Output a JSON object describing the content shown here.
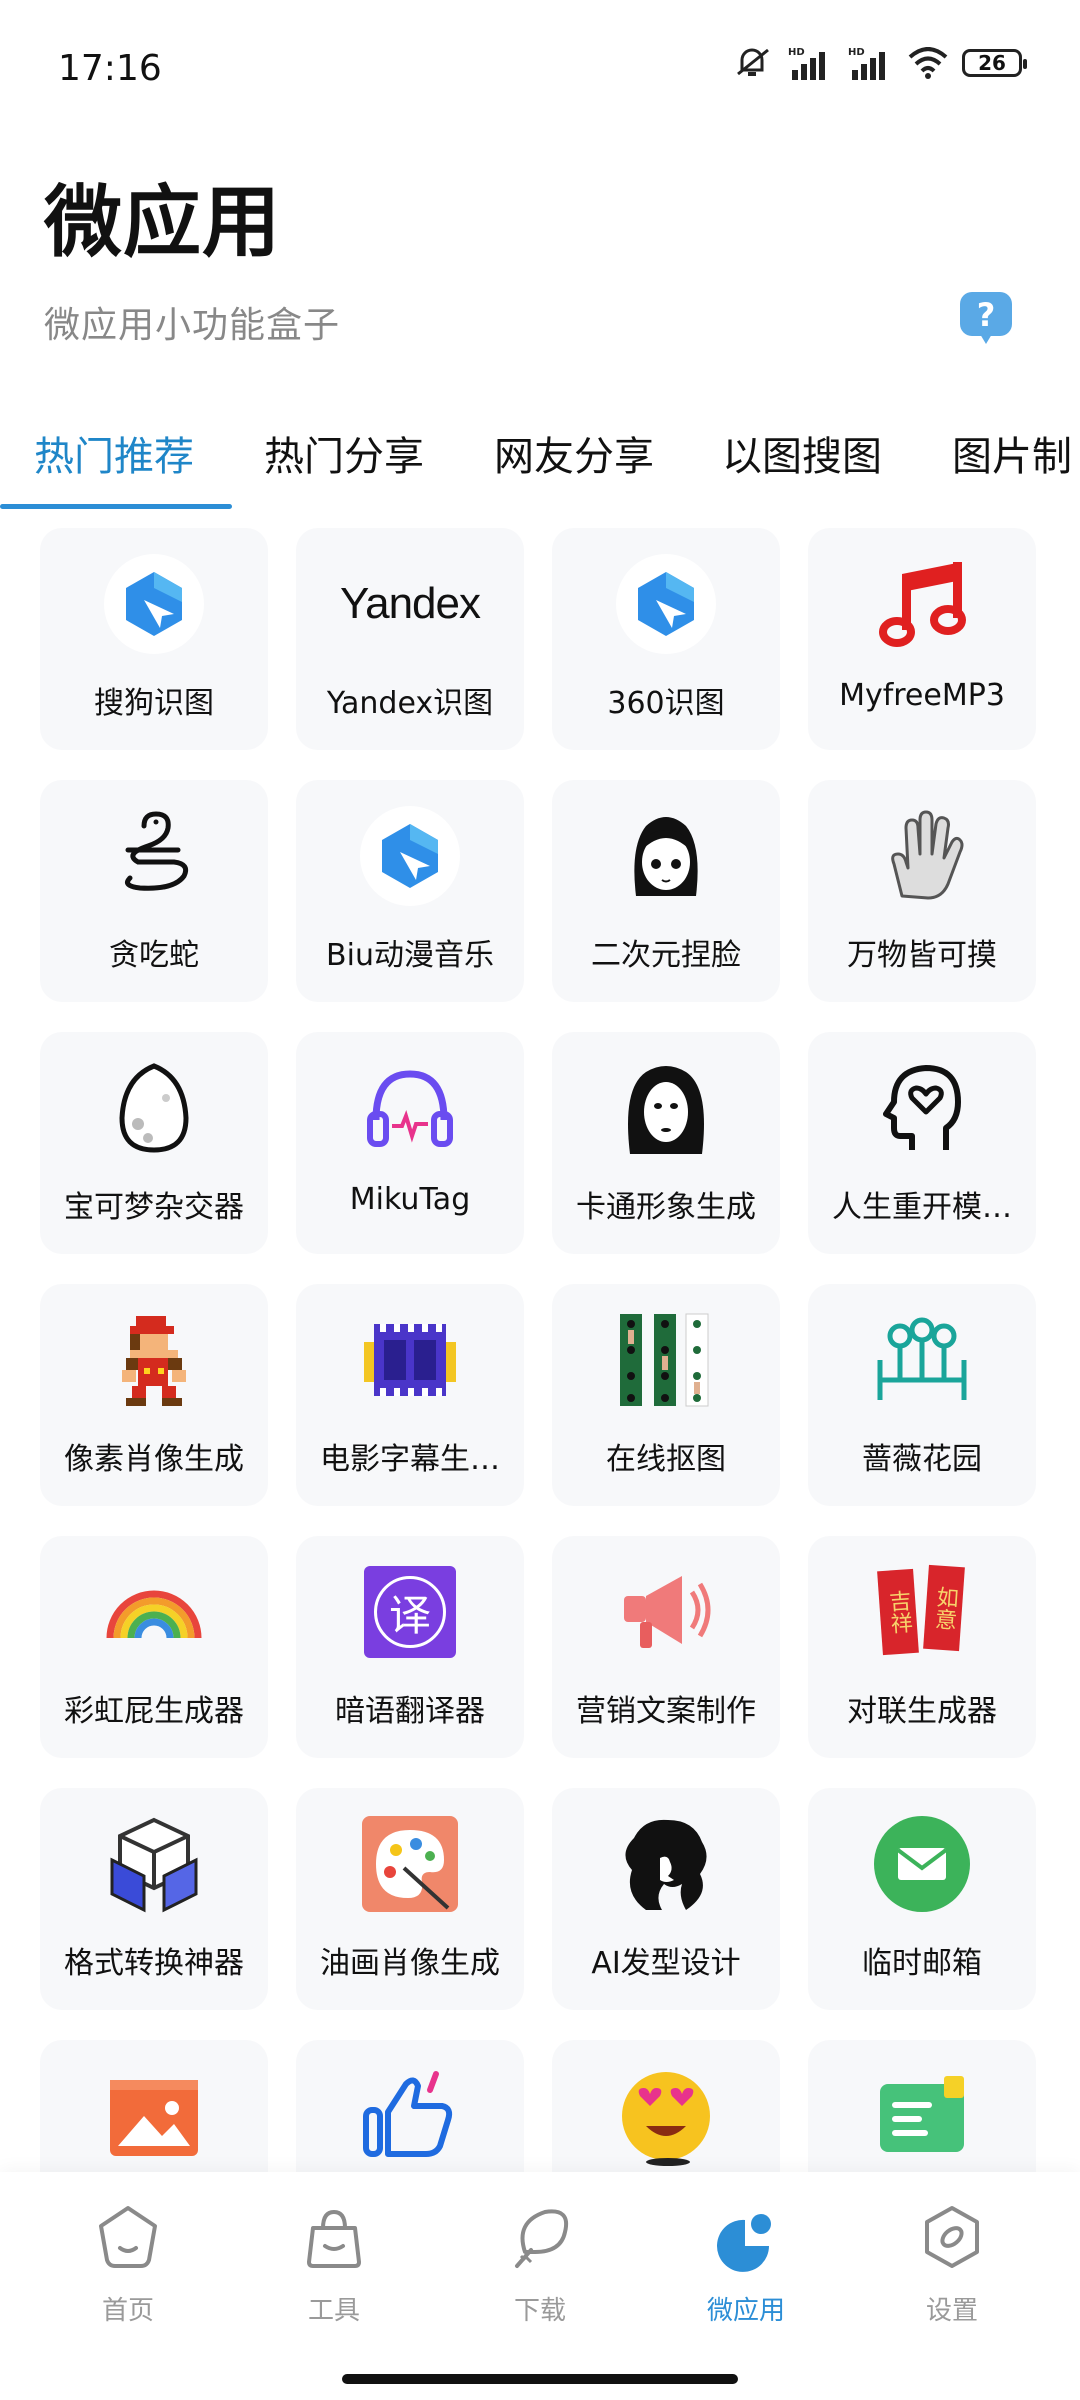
{
  "status_bar": {
    "time": "17:16",
    "battery": "26",
    "icons": [
      "mute-icon",
      "hd-signal-icon",
      "hd-signal-icon",
      "wifi-icon",
      "battery-icon"
    ]
  },
  "header": {
    "title": "微应用",
    "subtitle": "微应用小功能盒子",
    "help_icon": "question-bubble-icon"
  },
  "tabs": [
    {
      "label": "热门推荐",
      "active": true
    },
    {
      "label": "热门分享",
      "active": false
    },
    {
      "label": "网友分享",
      "active": false
    },
    {
      "label": "以图搜图",
      "active": false
    },
    {
      "label": "图片制",
      "active": false
    }
  ],
  "apps": [
    {
      "label": "搜狗识图",
      "icon": "blue-hexagon-icon"
    },
    {
      "label": "Yandex识图",
      "icon": "yandex-logo-icon",
      "icon_text": "Yandex"
    },
    {
      "label": "360识图",
      "icon": "blue-hexagon-icon"
    },
    {
      "label": "MyfreeMP3",
      "icon": "music-note-icon"
    },
    {
      "label": "贪吃蛇",
      "icon": "snake-icon"
    },
    {
      "label": "Biu动漫音乐",
      "icon": "blue-hexagon-icon"
    },
    {
      "label": "二次元捏脸",
      "icon": "anime-face-icon"
    },
    {
      "label": "万物皆可摸",
      "icon": "hand-icon"
    },
    {
      "label": "宝可梦杂交器",
      "icon": "egg-icon"
    },
    {
      "label": "MikuTag",
      "icon": "headphones-icon"
    },
    {
      "label": "卡通形象生成",
      "icon": "no-face-icon"
    },
    {
      "label": "人生重开模…",
      "icon": "head-heart-icon"
    },
    {
      "label": "像素肖像生成",
      "icon": "pixel-mario-icon"
    },
    {
      "label": "电影字幕生…",
      "icon": "film-strip-icon"
    },
    {
      "label": "在线抠图",
      "icon": "cutout-strip-icon"
    },
    {
      "label": "蔷薇花园",
      "icon": "garden-icon"
    },
    {
      "label": "彩虹屁生成器",
      "icon": "rainbow-icon"
    },
    {
      "label": "暗语翻译器",
      "icon": "translate-icon",
      "icon_text": "译"
    },
    {
      "label": "营销文案制作",
      "icon": "megaphone-icon"
    },
    {
      "label": "对联生成器",
      "icon": "couplet-icon",
      "icon_text_left": "吉祥",
      "icon_text_right": "如意"
    },
    {
      "label": "格式转换神器",
      "icon": "cube-convert-icon"
    },
    {
      "label": "油画肖像生成",
      "icon": "palette-icon"
    },
    {
      "label": "AI发型设计",
      "icon": "hair-silhouette-icon"
    },
    {
      "label": "临时邮箱",
      "icon": "mail-icon"
    },
    {
      "label": "",
      "icon": "image-icon"
    },
    {
      "label": "",
      "icon": "thumbs-up-icon"
    },
    {
      "label": "",
      "icon": "heart-eyes-emoji-icon"
    },
    {
      "label": "",
      "icon": "sim-card-icon"
    }
  ],
  "bottom_nav": [
    {
      "label": "首页",
      "icon": "home-blob-icon",
      "active": false
    },
    {
      "label": "工具",
      "icon": "bag-icon",
      "active": false
    },
    {
      "label": "下载",
      "icon": "download-leaf-icon",
      "active": false
    },
    {
      "label": "微应用",
      "icon": "micro-app-icon",
      "active": true
    },
    {
      "label": "设置",
      "icon": "settings-hex-icon",
      "active": false
    }
  ],
  "colors": {
    "accent": "#2c8ed6",
    "card_bg": "#f7f8fa",
    "subtitle": "#888888",
    "nav_inactive": "#9a9a9a"
  }
}
